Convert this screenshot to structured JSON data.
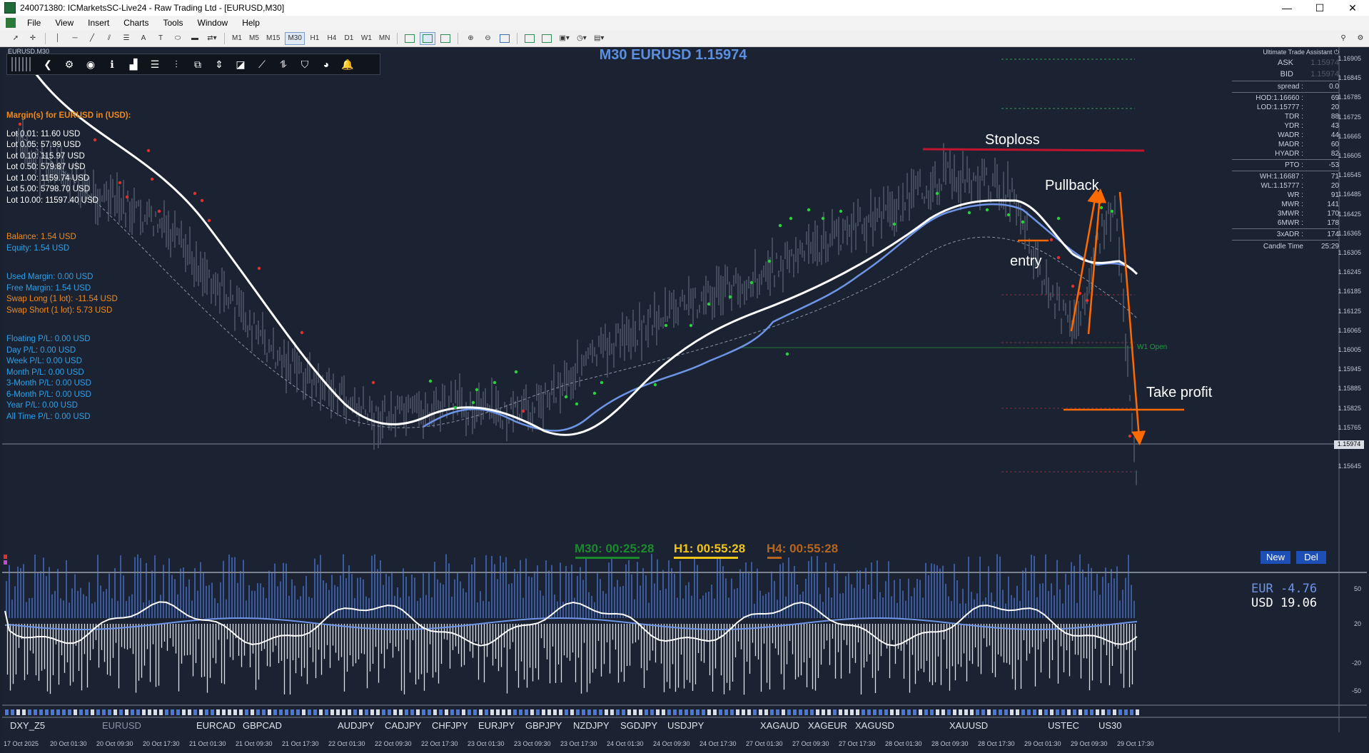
{
  "window": {
    "title": "240071380: ICMarketsSC-Live24 - Raw Trading Ltd - [EURUSD,M30]",
    "minimize": "—",
    "maximize": "☐",
    "close": "✕"
  },
  "menu": [
    "File",
    "View",
    "Insert",
    "Charts",
    "Tools",
    "Window",
    "Help"
  ],
  "toolbar": {
    "timeframes": [
      "M1",
      "M5",
      "M15",
      "M30",
      "H1",
      "H4",
      "D1",
      "W1",
      "MN"
    ],
    "active_timeframe": "M30"
  },
  "chart": {
    "label": "EURUSD,M30",
    "header": "M30 EURUSD 1.15974",
    "price_scale": [
      "1.16905",
      "1.16845",
      "1.16785",
      "1.16725",
      "1.16665",
      "1.16605",
      "1.16545",
      "1.16485",
      "1.16425",
      "1.16365",
      "1.16305",
      "1.16245",
      "1.16185",
      "1.16125",
      "1.16065",
      "1.16005",
      "1.15945",
      "1.15885",
      "1.15825",
      "1.15765",
      "1.15705",
      "1.15645"
    ],
    "current_price": "1.15974",
    "w1_open_label": "W1 Open",
    "colors": {
      "background": "#1b2333",
      "ma_fast": "#ffffff",
      "ma_slow": "#6e94e6",
      "annotation_arrow": "#ff6a00",
      "stoploss_line": "#c0142f"
    }
  },
  "account": {
    "margin_header": "Margin(s) for EURUSD in (USD):",
    "lots": [
      "Lot 0.01: 11.60 USD",
      "Lot 0.05: 57.99 USD",
      "Lot 0.10: 115.97 USD",
      "Lot 0.50: 579.87 USD",
      "Lot 1.00: 1159.74 USD",
      "Lot 5.00: 5798.70 USD",
      "Lot 10.00: 11597.40 USD"
    ],
    "balance": "Balance: 1.54 USD",
    "equity": "Equity: 1.54 USD",
    "used_margin": "Used Margin: 0.00 USD",
    "free_margin": "Free Margin: 1.54 USD",
    "swap_long": "Swap Long (1 lot): -11.54 USD",
    "swap_short": "Swap Short (1 lot): 5.73 USD",
    "pl": [
      "Floating P/L: 0.00 USD",
      "Day P/L: 0.00 USD",
      "Week P/L: 0.00 USD",
      "Month P/L: 0.00 USD",
      "3-Month P/L: 0.00 USD",
      "6-Month P/L: 0.00 USD",
      "Year P/L: 0.00 USD",
      "All Time P/L: 0.00 USD"
    ]
  },
  "uta_panel": {
    "title": "Ultimate Trade Assistant",
    "ask_label": "ASK",
    "ask": "1.15974",
    "bid_label": "BID",
    "bid": "1.15974",
    "rows": [
      {
        "k": "spread :",
        "v": "0.0"
      },
      {
        "k": "HOD:1.16660 :",
        "v": "69"
      },
      {
        "k": "LOD:1.15777 :",
        "v": "20"
      },
      {
        "k": "TDR :",
        "v": "88"
      },
      {
        "k": "YDR :",
        "v": "43"
      },
      {
        "k": "WADR :",
        "v": "44"
      },
      {
        "k": "MADR :",
        "v": "60"
      },
      {
        "k": "HYADR :",
        "v": "82"
      },
      {
        "k": "PTO :",
        "v": "-53"
      },
      {
        "k": "WH:1.16687 :",
        "v": "71"
      },
      {
        "k": "WL:1.15777 :",
        "v": "20"
      },
      {
        "k": "WR :",
        "v": "91"
      },
      {
        "k": "MWR :",
        "v": "141"
      },
      {
        "k": "3MWR :",
        "v": "170"
      },
      {
        "k": "6MWR :",
        "v": "178"
      },
      {
        "k": "3xADR :",
        "v": "174"
      }
    ],
    "candle_time_label": "Candle Time",
    "candle_time": "25:29"
  },
  "annotations": {
    "stoploss": "Stoploss",
    "pullback": "Pullback",
    "entry": "entry",
    "take_profit": "Take profit"
  },
  "timers": {
    "m30": "M30: 00:25:28",
    "h1": "H1: 00:55:28",
    "h4": "H4: 00:55:28"
  },
  "buttons": {
    "new": "New",
    "del": "Del"
  },
  "subwindow": {
    "eur": "EUR  -4.76",
    "usd": "USD 19.06",
    "scale": [
      "50",
      "20",
      "-20",
      "-50"
    ]
  },
  "symbols": [
    "DXY_Z5",
    "EURUSD",
    "EURCAD",
    "GBPCAD",
    "AUDJPY",
    "CADJPY",
    "CHFJPY",
    "EURJPY",
    "GBPJPY",
    "NZDJPY",
    "SGDJPY",
    "USDJPY",
    "XAGAUD",
    "XAGEUR",
    "XAGUSD",
    "XAUUSD",
    "USTEC",
    "US30"
  ],
  "time_axis": [
    "17 Oct 2025",
    "20 Oct 01:30",
    "20 Oct 09:30",
    "20 Oct 17:30",
    "21 Oct 01:30",
    "21 Oct 09:30",
    "21 Oct 17:30",
    "22 Oct 01:30",
    "22 Oct 09:30",
    "22 Oct 17:30",
    "23 Oct 01:30",
    "23 Oct 09:30",
    "23 Oct 17:30",
    "24 Oct 01:30",
    "24 Oct 09:30",
    "24 Oct 17:30",
    "27 Oct 01:30",
    "27 Oct 09:30",
    "27 Oct 17:30",
    "28 Oct 01:30",
    "28 Oct 09:30",
    "28 Oct 17:30",
    "29 Oct 01:30",
    "29 Oct 09:30",
    "29 Oct 17:30"
  ]
}
